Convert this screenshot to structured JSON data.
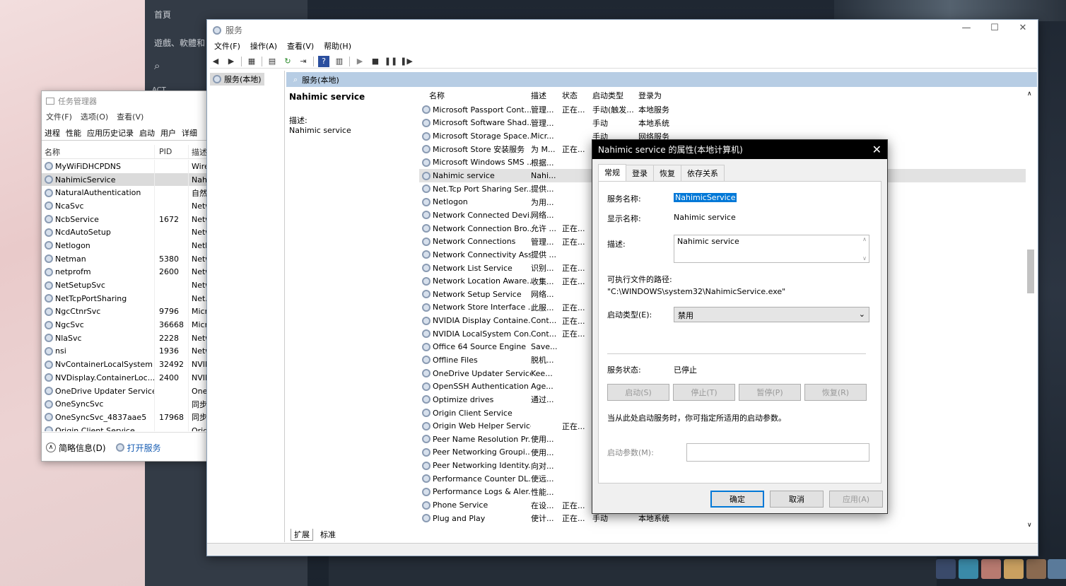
{
  "steam": {
    "home": "首頁",
    "nav_games": "遊戲、軟體和",
    "section_label": "ACT"
  },
  "taskmgr": {
    "title": "任务管理器",
    "menu": [
      "文件(F)",
      "选项(O)",
      "查看(V)"
    ],
    "tabs": [
      "进程",
      "性能",
      "应用历史记录",
      "启动",
      "用户",
      "详细"
    ],
    "columns": {
      "name": "名称",
      "pid": "PID",
      "desc": "描述"
    },
    "rows": [
      {
        "name": "MyWiFiDHCPDNS",
        "pid": "",
        "desc": "Wire"
      },
      {
        "name": "NahimicService",
        "pid": "",
        "desc": "Nahi"
      },
      {
        "name": "NaturalAuthentication",
        "pid": "",
        "desc": "自然身"
      },
      {
        "name": "NcaSvc",
        "pid": "",
        "desc": "Netw"
      },
      {
        "name": "NcbService",
        "pid": "1672",
        "desc": "Netw"
      },
      {
        "name": "NcdAutoSetup",
        "pid": "",
        "desc": "Netw"
      },
      {
        "name": "Netlogon",
        "pid": "",
        "desc": "Netlo"
      },
      {
        "name": "Netman",
        "pid": "5380",
        "desc": "Netw"
      },
      {
        "name": "netprofm",
        "pid": "2600",
        "desc": "Netw"
      },
      {
        "name": "NetSetupSvc",
        "pid": "",
        "desc": "Netw"
      },
      {
        "name": "NetTcpPortSharing",
        "pid": "",
        "desc": "Net.T"
      },
      {
        "name": "NgcCtnrSvc",
        "pid": "9796",
        "desc": "Micro"
      },
      {
        "name": "NgcSvc",
        "pid": "36668",
        "desc": "Micro"
      },
      {
        "name": "NlaSvc",
        "pid": "2228",
        "desc": "Netw"
      },
      {
        "name": "nsi",
        "pid": "1936",
        "desc": "Netw"
      },
      {
        "name": "NvContainerLocalSystem",
        "pid": "32492",
        "desc": "NVID"
      },
      {
        "name": "NVDisplay.ContainerLoc...",
        "pid": "2400",
        "desc": "NVID"
      },
      {
        "name": "OneDrive Updater Service",
        "pid": "",
        "desc": "OneD"
      },
      {
        "name": "OneSyncSvc",
        "pid": "",
        "desc": "同步主"
      },
      {
        "name": "OneSyncSvc_4837aae5",
        "pid": "17968",
        "desc": "同步主"
      },
      {
        "name": "Origin Client Service",
        "pid": "",
        "desc": "Origi"
      }
    ],
    "footer": {
      "less": "简略信息(D)",
      "open_services": "打开服务"
    }
  },
  "services": {
    "title": "服务",
    "menu": [
      "文件(F)",
      "操作(A)",
      "查看(V)",
      "帮助(H)"
    ],
    "tree_node": "服务(本地)",
    "header_bar": "服务(本地)",
    "selected_name": "Nahimic service",
    "desc_label": "描述:",
    "desc_value": "Nahimic service",
    "columns": {
      "name": "名称",
      "desc": "描述",
      "state": "状态",
      "start": "启动类型",
      "logon": "登录为"
    },
    "rows": [
      {
        "name": "Microsoft Passport Cont...",
        "desc": "管理...",
        "state": "正在...",
        "start": "手动(触发...",
        "logon": "本地服务"
      },
      {
        "name": "Microsoft Software Shad...",
        "desc": "管理...",
        "state": "",
        "start": "手动",
        "logon": "本地系统"
      },
      {
        "name": "Microsoft Storage Space...",
        "desc": "Micr...",
        "state": "",
        "start": "手动",
        "logon": "网络服务"
      },
      {
        "name": "Microsoft Store 安装服务",
        "desc": "为 M...",
        "state": "正在...",
        "start": "",
        "logon": ""
      },
      {
        "name": "Microsoft Windows SMS ...",
        "desc": "根据...",
        "state": "",
        "start": "",
        "logon": ""
      },
      {
        "name": "Nahimic service",
        "desc": "Nahi...",
        "state": "",
        "start": "",
        "logon": ""
      },
      {
        "name": "Net.Tcp Port Sharing Ser...",
        "desc": "提供...",
        "state": "",
        "start": "",
        "logon": ""
      },
      {
        "name": "Netlogon",
        "desc": "为用...",
        "state": "",
        "start": "",
        "logon": ""
      },
      {
        "name": "Network Connected Devi...",
        "desc": "网络...",
        "state": "",
        "start": "",
        "logon": ""
      },
      {
        "name": "Network Connection Bro...",
        "desc": "允许 ...",
        "state": "正在...",
        "start": "",
        "logon": ""
      },
      {
        "name": "Network Connections",
        "desc": "管理...",
        "state": "正在...",
        "start": "",
        "logon": ""
      },
      {
        "name": "Network Connectivity Ass...",
        "desc": "提供 ...",
        "state": "",
        "start": "",
        "logon": ""
      },
      {
        "name": "Network List Service",
        "desc": "识别...",
        "state": "正在...",
        "start": "",
        "logon": ""
      },
      {
        "name": "Network Location Aware...",
        "desc": "收集...",
        "state": "正在...",
        "start": "",
        "logon": ""
      },
      {
        "name": "Network Setup Service",
        "desc": "网络...",
        "state": "",
        "start": "",
        "logon": ""
      },
      {
        "name": "Network Store Interface ...",
        "desc": "此服...",
        "state": "正在...",
        "start": "",
        "logon": ""
      },
      {
        "name": "NVIDIA Display Containe...",
        "desc": "Cont...",
        "state": "正在...",
        "start": "",
        "logon": ""
      },
      {
        "name": "NVIDIA LocalSystem Con...",
        "desc": "Cont...",
        "state": "正在...",
        "start": "",
        "logon": ""
      },
      {
        "name": "Office 64 Source Engine",
        "desc": "Save...",
        "state": "",
        "start": "",
        "logon": ""
      },
      {
        "name": "Offline Files",
        "desc": "脱机...",
        "state": "",
        "start": "",
        "logon": ""
      },
      {
        "name": "OneDrive Updater Service",
        "desc": "Kee...",
        "state": "",
        "start": "",
        "logon": ""
      },
      {
        "name": "OpenSSH Authentication ...",
        "desc": "Age...",
        "state": "",
        "start": "",
        "logon": ""
      },
      {
        "name": "Optimize drives",
        "desc": "通过...",
        "state": "",
        "start": "",
        "logon": ""
      },
      {
        "name": "Origin Client Service",
        "desc": "",
        "state": "",
        "start": "",
        "logon": ""
      },
      {
        "name": "Origin Web Helper Service",
        "desc": "",
        "state": "正在...",
        "start": "",
        "logon": ""
      },
      {
        "name": "Peer Name Resolution Pr...",
        "desc": "使用...",
        "state": "",
        "start": "",
        "logon": ""
      },
      {
        "name": "Peer Networking Groupi...",
        "desc": "使用...",
        "state": "",
        "start": "",
        "logon": ""
      },
      {
        "name": "Peer Networking Identity...",
        "desc": "向对...",
        "state": "",
        "start": "",
        "logon": ""
      },
      {
        "name": "Performance Counter DL...",
        "desc": "使远...",
        "state": "",
        "start": "",
        "logon": ""
      },
      {
        "name": "Performance Logs & Aler...",
        "desc": "性能...",
        "state": "",
        "start": "",
        "logon": ""
      },
      {
        "name": "Phone Service",
        "desc": "在设...",
        "state": "正在...",
        "start": "",
        "logon": ""
      },
      {
        "name": "Plug and Play",
        "desc": "使计...",
        "state": "正在...",
        "start": "手动",
        "logon": "本地系统"
      }
    ],
    "bottom_tabs": [
      "扩展",
      "标准"
    ]
  },
  "dialog": {
    "title": "Nahimic service 的属性(本地计算机)",
    "tabs": [
      "常规",
      "登录",
      "恢复",
      "依存关系"
    ],
    "service_name_label": "服务名称:",
    "service_name": "NahimicService",
    "display_name_label": "显示名称:",
    "display_name": "Nahimic service",
    "desc_label": "描述:",
    "desc": "Nahimic service",
    "path_label": "可执行文件的路径:",
    "path": "\"C:\\WINDOWS\\system32\\NahimicService.exe\"",
    "startup_label": "启动类型(E):",
    "startup_value": "禁用",
    "status_label": "服务状态:",
    "status_value": "已停止",
    "btn_start": "启动(S)",
    "btn_stop": "停止(T)",
    "btn_pause": "暂停(P)",
    "btn_resume": "恢复(R)",
    "hint": "当从此处启动服务时，你可指定所适用的启动参数。",
    "param_label": "启动参数(M):",
    "ok": "确定",
    "cancel": "取消",
    "apply": "应用(A)"
  }
}
